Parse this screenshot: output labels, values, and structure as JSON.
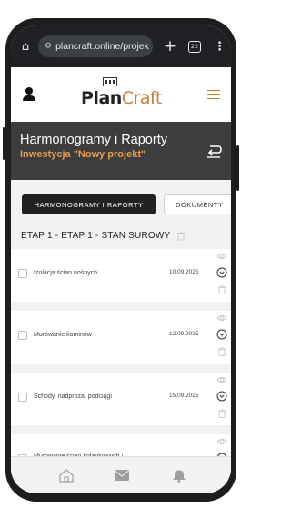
{
  "browser": {
    "url": "plancraft.online/projek",
    "tab_count": "22"
  },
  "header": {
    "logo_plan": "Plan",
    "logo_craft": "Craft"
  },
  "page": {
    "title": "Harmonogramy i Raporty",
    "subtitle": "Inwestycja \"Nowy projekt\""
  },
  "tabs": [
    {
      "label": "HARMONOGRAMY I RAPORTY",
      "active": true
    },
    {
      "label": "DOKUMENTY",
      "active": false
    }
  ],
  "stage": {
    "heading": "ETAP 1 - ETAP 1 - STAN SUROWY"
  },
  "tasks": [
    {
      "name": "Izolacja ścian nośnych",
      "date": "10.09.2025"
    },
    {
      "name": "Murowanie kominów",
      "date": "12.09.2025"
    },
    {
      "name": "Schody, nadproża, podciągi",
      "date": "15.09.2025"
    },
    {
      "name": "Murowanie ścian kolankowych i",
      "date": ""
    }
  ],
  "colors": {
    "accent": "#c47f3e",
    "subtitle": "#e59d55",
    "title_band": "#3d3d3d"
  }
}
